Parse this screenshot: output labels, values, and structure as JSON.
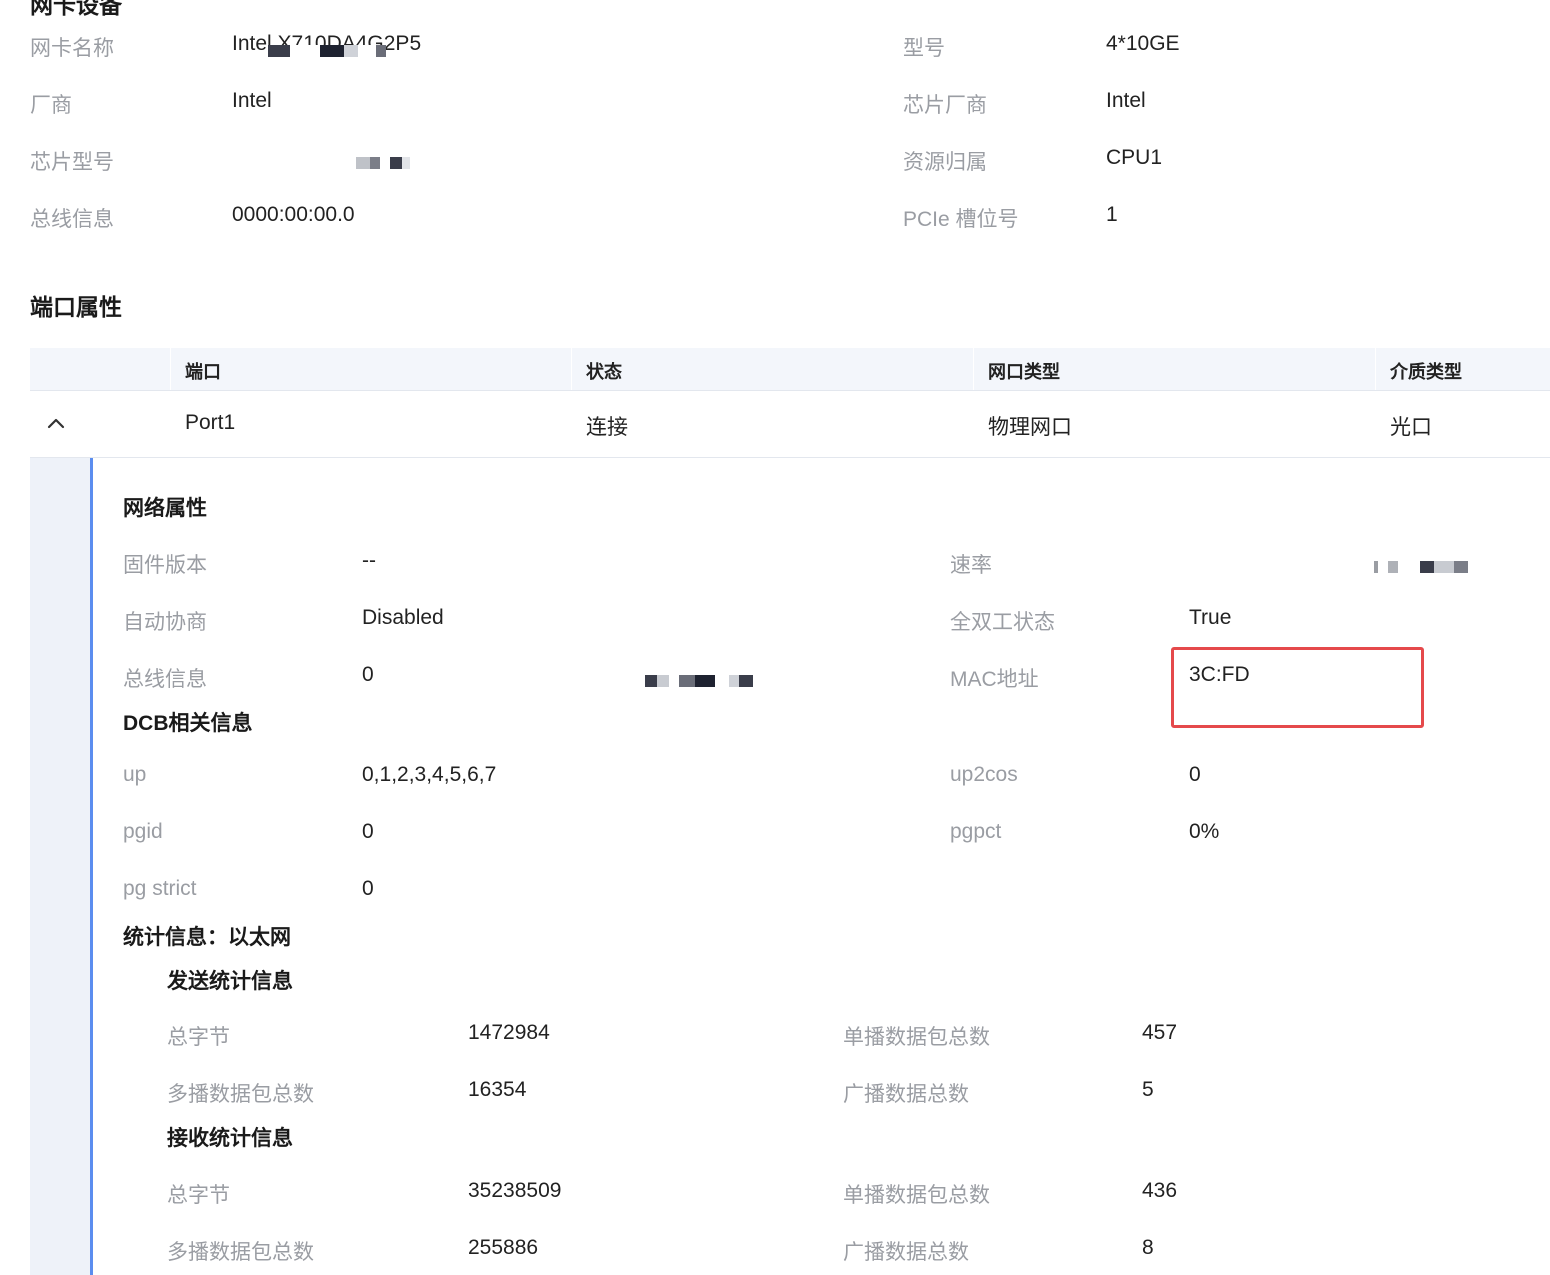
{
  "device": {
    "title": "网卡设备",
    "fields": [
      {
        "label": "网卡名称",
        "value": "Intel X710DA4G2P5"
      },
      {
        "label": "型号",
        "value": "4*10GE"
      },
      {
        "label": "厂商",
        "value": "Intel"
      },
      {
        "label": "芯片厂商",
        "value": "Intel"
      },
      {
        "label": "芯片型号",
        "value": ""
      },
      {
        "label": "资源归属",
        "value": "CPU1"
      },
      {
        "label": "总线信息",
        "value": "0000:00:00.0"
      },
      {
        "label": "PCIe 槽位号",
        "value": "1"
      }
    ]
  },
  "ports": {
    "title": "端口属性",
    "columns": [
      "端口",
      "状态",
      "网口类型",
      "介质类型"
    ],
    "rows": [
      {
        "cells": [
          "Port1",
          "连接",
          "物理网口",
          "光口"
        ]
      }
    ]
  },
  "network": {
    "title": "网络属性",
    "fields": [
      {
        "label": "固件版本",
        "value": "--"
      },
      {
        "label": "速率",
        "value": ""
      },
      {
        "label": "自动协商",
        "value": "Disabled"
      },
      {
        "label": "全双工状态",
        "value": "True"
      },
      {
        "label": "总线信息",
        "value": "0"
      },
      {
        "label": "MAC地址",
        "value": "3C:FD"
      }
    ]
  },
  "dcb": {
    "title": "DCB相关信息",
    "fields": [
      {
        "label": "up",
        "value": "0,1,2,3,4,5,6,7"
      },
      {
        "label": "up2cos",
        "value": "0"
      },
      {
        "label": "pgid",
        "value": "0"
      },
      {
        "label": "pgpct",
        "value": "0%"
      },
      {
        "label": "pg strict",
        "value": "0"
      }
    ]
  },
  "stats": {
    "title": "统计信息：以太网",
    "tx": {
      "title": "发送统计信息",
      "fields": [
        {
          "label": "总字节",
          "value": "1472984"
        },
        {
          "label": "单播数据包总数",
          "value": "457"
        },
        {
          "label": "多播数据包总数",
          "value": "16354"
        },
        {
          "label": "广播数据总数",
          "value": "5"
        }
      ]
    },
    "rx": {
      "title": "接收统计信息",
      "fields": [
        {
          "label": "总字节",
          "value": "35238509"
        },
        {
          "label": "单播数据包总数",
          "value": "436"
        },
        {
          "label": "多播数据包总数",
          "value": "255886"
        },
        {
          "label": "广播数据总数",
          "value": "8"
        }
      ]
    }
  },
  "colors": {
    "accent": "#5b8def",
    "highlight_box": "#e5494b",
    "header_bg": "#f3f6fb",
    "label": "#9a9da3"
  },
  "icons": {
    "row_toggle": "chevron-up-icon"
  }
}
